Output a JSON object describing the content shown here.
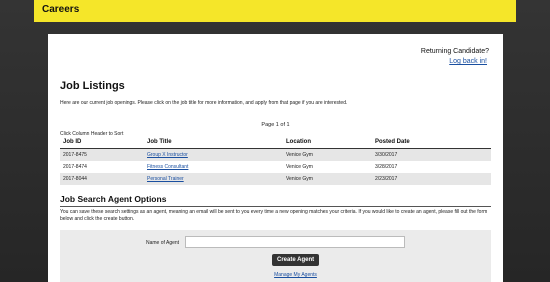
{
  "header": {
    "title": "Careers"
  },
  "login": {
    "prompt": "Returning Candidate?",
    "link_label": "Log back in!"
  },
  "listings": {
    "heading": "Job Listings",
    "intro": "Here are our current job openings. Please click on the job title for more information, and apply from that page if you are interested.",
    "pagination": "Page 1 of 1",
    "sort_hint": "Click Column Header to Sort",
    "columns": [
      "Job ID",
      "Job Title",
      "Location",
      "Posted Date"
    ],
    "rows": [
      {
        "id": "2017-8475",
        "title": "Group X Instructor",
        "location": "Venice Gym",
        "date": "3/30/2017"
      },
      {
        "id": "2017-8474",
        "title": "Fitness Consultant",
        "location": "Venice Gym",
        "date": "3/28/2017"
      },
      {
        "id": "2017-8044",
        "title": "Personal Trainer",
        "location": "Venice Gym",
        "date": "2/23/2017"
      }
    ]
  },
  "agent": {
    "heading": "Job Search Agent Options",
    "description": "You can save these search settings as an agent, meaning an email will be sent to you every time a new opening matches your criteria. If you would like to create an agent, please fill out the form below and click the create button.",
    "name_label": "Name of Agent",
    "name_value": "",
    "create_label": "Create Agent",
    "manage_label": "Manage My Agents"
  }
}
